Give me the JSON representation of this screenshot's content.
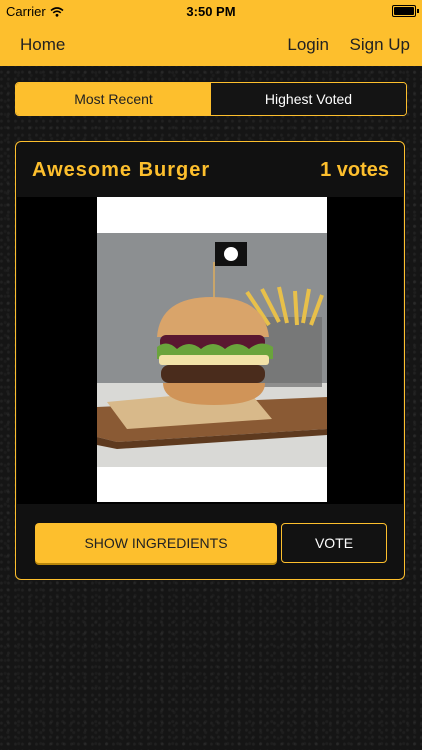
{
  "status_bar": {
    "carrier": "Carrier",
    "time": "3:50 PM"
  },
  "navbar": {
    "home": "Home",
    "login": "Login",
    "signup": "Sign Up"
  },
  "segmented": {
    "most_recent": "Most Recent",
    "highest_voted": "Highest Voted",
    "selected": "Most Recent"
  },
  "post": {
    "title": "Awesome Burger",
    "votes": "1 votes",
    "show_ingredients": "SHOW INGREDIENTS",
    "vote": "VOTE"
  },
  "colors": {
    "accent": "#fdbf2d",
    "background": "#151515"
  }
}
